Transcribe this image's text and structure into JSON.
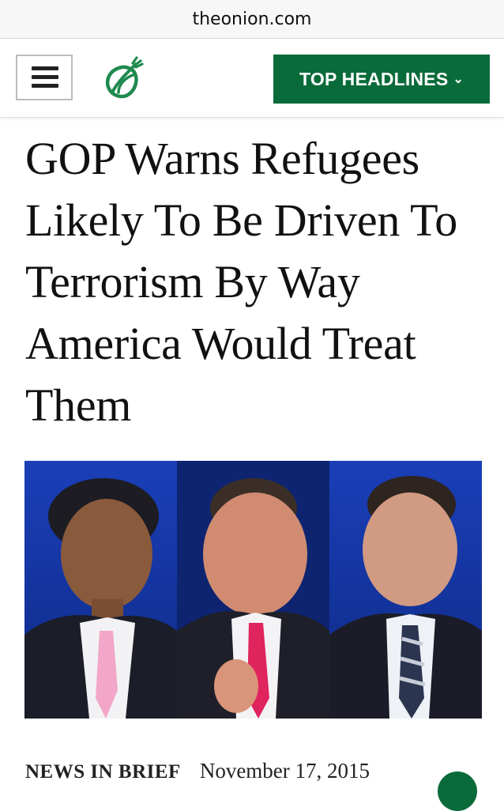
{
  "browser": {
    "url": "theonion.com"
  },
  "header": {
    "menu_icon": "hamburger-menu-icon",
    "logo_icon": "onion-logo-icon",
    "top_headlines_label": "TOP HEADLINES",
    "chevron_icon": "chevron-down-icon"
  },
  "article": {
    "headline": "GOP Warns Refugees Likely To Be Driven To Terrorism By Way America Would Treat Them",
    "section": "NEWS IN BRIEF",
    "date": "November 17, 2015"
  },
  "colors": {
    "brand_green": "#0a6b3a"
  }
}
